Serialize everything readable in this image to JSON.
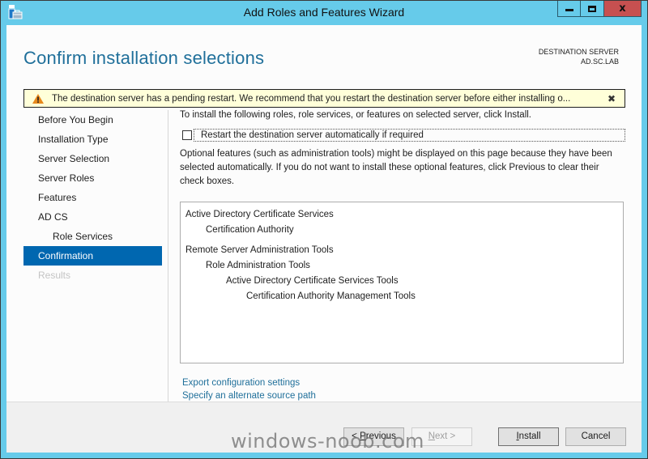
{
  "window": {
    "title": "Add Roles and Features Wizard",
    "controls": {
      "minimize": "minimize",
      "maximize": "maximize",
      "close": "close"
    },
    "colors": {
      "frame": "#66cbea",
      "close_button": "#c75050",
      "accent": "#0067b0",
      "title_text": "#1f6f9a"
    }
  },
  "header": {
    "page_title": "Confirm installation selections",
    "destination_label": "DESTINATION SERVER",
    "destination_value": "AD.SC.LAB"
  },
  "warning": {
    "icon": "warning-triangle-icon",
    "text": "The destination server has a pending restart. We recommend that you restart the destination server before either installing o...",
    "close_glyph": "✖"
  },
  "nav": {
    "items": [
      {
        "label": "Before You Begin",
        "state": "normal"
      },
      {
        "label": "Installation Type",
        "state": "normal"
      },
      {
        "label": "Server Selection",
        "state": "normal"
      },
      {
        "label": "Server Roles",
        "state": "normal"
      },
      {
        "label": "Features",
        "state": "normal"
      },
      {
        "label": "AD CS",
        "state": "normal"
      },
      {
        "label": "Role Services",
        "state": "sub"
      },
      {
        "label": "Confirmation",
        "state": "active"
      },
      {
        "label": "Results",
        "state": "disabled"
      }
    ]
  },
  "content": {
    "intro": "To install the following roles, role services, or features on selected server, click Install.",
    "restart_checkbox": {
      "label": "Restart the destination server automatically if required",
      "checked": false
    },
    "optional_note": "Optional features (such as administration tools) might be displayed on this page because they have been selected automatically. If you do not want to install these optional features, click Previous to clear their check boxes.",
    "summary": [
      {
        "text": "Active Directory Certificate Services",
        "level": 0
      },
      {
        "text": "Certification Authority",
        "level": 1
      },
      {
        "text": "Remote Server Administration Tools",
        "level": 0
      },
      {
        "text": "Role Administration Tools",
        "level": 1
      },
      {
        "text": "Active Directory Certificate Services Tools",
        "level": 2
      },
      {
        "text": "Certification Authority Management Tools",
        "level": 3
      }
    ],
    "links": {
      "export": "Export configuration settings",
      "alternate_source": "Specify an alternate source path"
    }
  },
  "footer": {
    "previous": {
      "prefix": "< ",
      "accel": "P",
      "rest": "revious",
      "enabled": true
    },
    "next": {
      "prefix": "",
      "accel": "N",
      "rest": "ext >",
      "enabled": false
    },
    "install": {
      "prefix": "",
      "accel": "I",
      "rest": "nstall",
      "enabled": true
    },
    "cancel": {
      "label": "Cancel",
      "enabled": true
    }
  },
  "watermark": "windows-noob.com"
}
